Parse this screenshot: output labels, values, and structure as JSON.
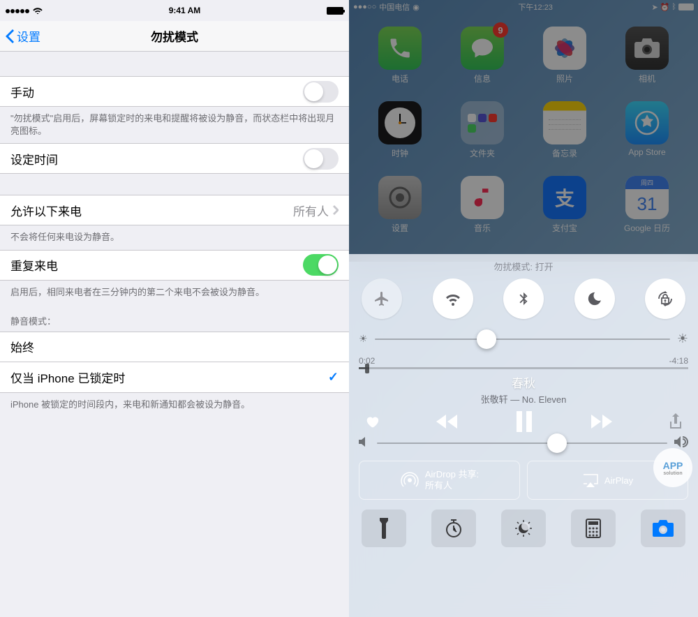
{
  "left": {
    "status": {
      "time": "9:41 AM"
    },
    "back": "设置",
    "title": "勿扰模式",
    "manual": {
      "label": "手动",
      "on": false
    },
    "manual_note": "\"勿扰模式\"启用后，屏幕锁定时的来电和提醒将被设为静音，而状态栏中将出现月亮图标。",
    "scheduled": {
      "label": "设定时间",
      "on": false
    },
    "allow_calls": {
      "label": "允许以下来电",
      "value": "所有人"
    },
    "allow_calls_note": "不会将任何来电设为静音。",
    "repeat_calls": {
      "label": "重复来电",
      "on": true
    },
    "repeat_calls_note": "启用后，相同来电者在三分钟内的第二个来电不会被设为静音。",
    "silence_header": "静音模式：",
    "always": "始终",
    "locked": "仅当 iPhone 已锁定时",
    "locked_note": "iPhone 被锁定的时间段内，来电和新通知都会被设为静音。"
  },
  "right": {
    "status": {
      "carrier": "中国电信",
      "time": "下午12:23"
    },
    "apps": [
      {
        "label": "电话",
        "bg": "linear-gradient(#7ED957,#34C759)",
        "glyph": "phone"
      },
      {
        "label": "信息",
        "bg": "linear-gradient(#7ED957,#34C759)",
        "glyph": "message",
        "badge": "9"
      },
      {
        "label": "照片",
        "bg": "#fff",
        "glyph": "photos"
      },
      {
        "label": "相机",
        "bg": "linear-gradient(#555,#333)",
        "glyph": "camera"
      },
      {
        "label": "时钟",
        "bg": "#1c1c1e",
        "glyph": "clock"
      },
      {
        "label": "文件夹",
        "bg": "rgba(255,255,255,.35)",
        "glyph": "folder"
      },
      {
        "label": "备忘录",
        "bg": "#fff",
        "glyph": "notes"
      },
      {
        "label": "App Store",
        "bg": "linear-gradient(#3EDCFF,#1E90FF)",
        "glyph": "appstore"
      },
      {
        "label": "设置",
        "bg": "linear-gradient(#ccc,#999)",
        "glyph": "settings"
      },
      {
        "label": "音乐",
        "bg": "#fff",
        "glyph": "music"
      },
      {
        "label": "支付宝",
        "bg": "#1677FF",
        "glyph": "alipay"
      },
      {
        "label": "Google 日历",
        "bg": "#fff",
        "glyph": "calendar"
      }
    ],
    "cc_status": "勿扰模式: 打开",
    "elapsed": "0:02",
    "remaining": "-4:18",
    "song": "春秋",
    "artist": "张敬轩 — No. Eleven",
    "airdrop_label": "AirDrop 共享:",
    "airdrop_value": "所有人",
    "airplay": "AirPlay"
  }
}
